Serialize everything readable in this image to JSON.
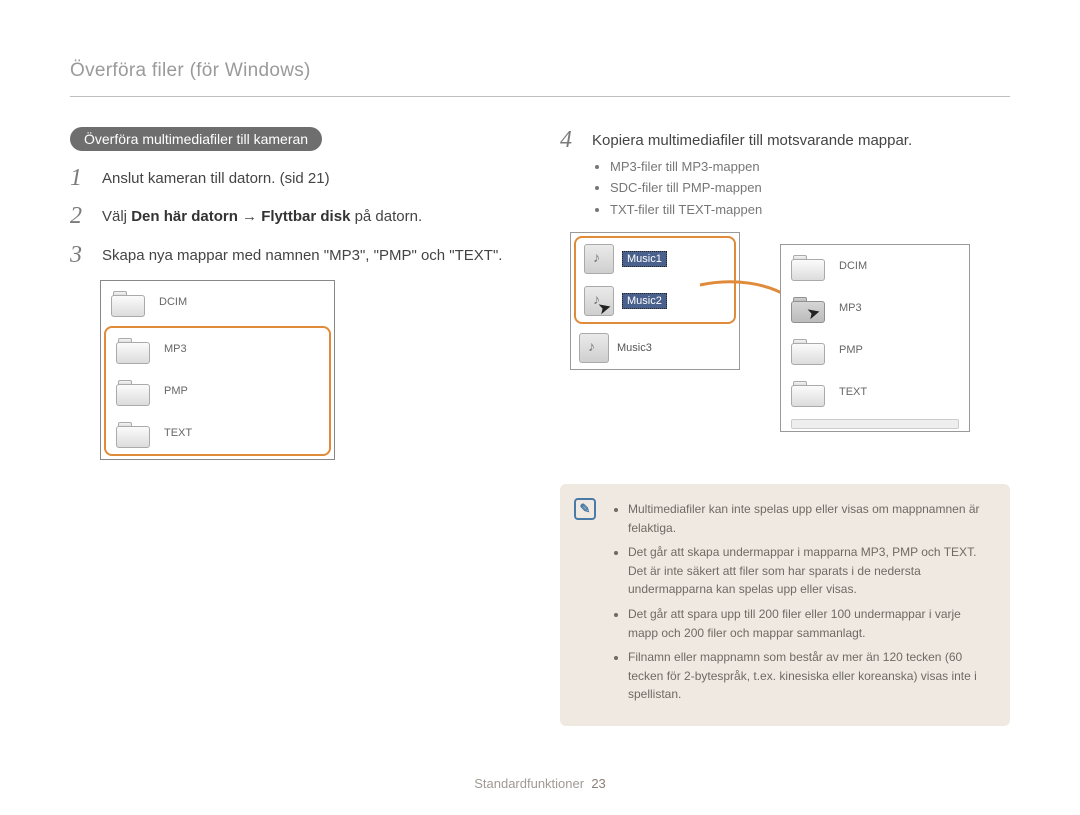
{
  "header": {
    "title": "Överföra filer (för Windows)"
  },
  "section": {
    "pill": "Överföra multimediafiler till kameran"
  },
  "left": {
    "steps": [
      {
        "num": "1",
        "text": "Anslut kameran till datorn. (sid 21)"
      },
      {
        "num": "2",
        "prefix": "Välj ",
        "bold1": "Den här datorn",
        "arrow": " → ",
        "bold2": "Flyttbar disk",
        "suffix": " på datorn."
      },
      {
        "num": "3",
        "text": "Skapa nya mappar med namnen \"MP3\", \"PMP\" och \"TEXT\"."
      }
    ],
    "folders": {
      "top": "DCIM",
      "highlighted": [
        "MP3",
        "PMP",
        "TEXT"
      ]
    }
  },
  "right": {
    "step4": {
      "num": "4",
      "text": "Kopiera multimediafiler till motsvarande mappar."
    },
    "bullets": [
      "MP3-filer till MP3-mappen",
      "SDC-filer till PMP-mappen",
      "TXT-filer till TEXT-mappen"
    ],
    "src": {
      "selected": [
        "Music1",
        "Music2"
      ],
      "other": "Music3"
    },
    "dst": [
      "DCIM",
      "MP3",
      "PMP",
      "TEXT"
    ]
  },
  "note": {
    "items": [
      "Multimediafiler kan inte spelas upp eller visas om mappnamnen är felaktiga.",
      "Det går att skapa undermappar i mapparna MP3, PMP och TEXT. Det är inte säkert att filer som har sparats i de nedersta undermapparna kan spelas upp eller visas.",
      "Det går att spara upp till 200 filer eller 100 undermappar i varje mapp och 200 filer och mappar sammanlagt.",
      "Filnamn eller mappnamn som består av mer än 120 tecken (60 tecken för 2-bytespråk, t.ex. kinesiska eller koreanska) visas inte i spellistan."
    ]
  },
  "footer": {
    "label": "Standardfunktioner",
    "page": "23"
  }
}
